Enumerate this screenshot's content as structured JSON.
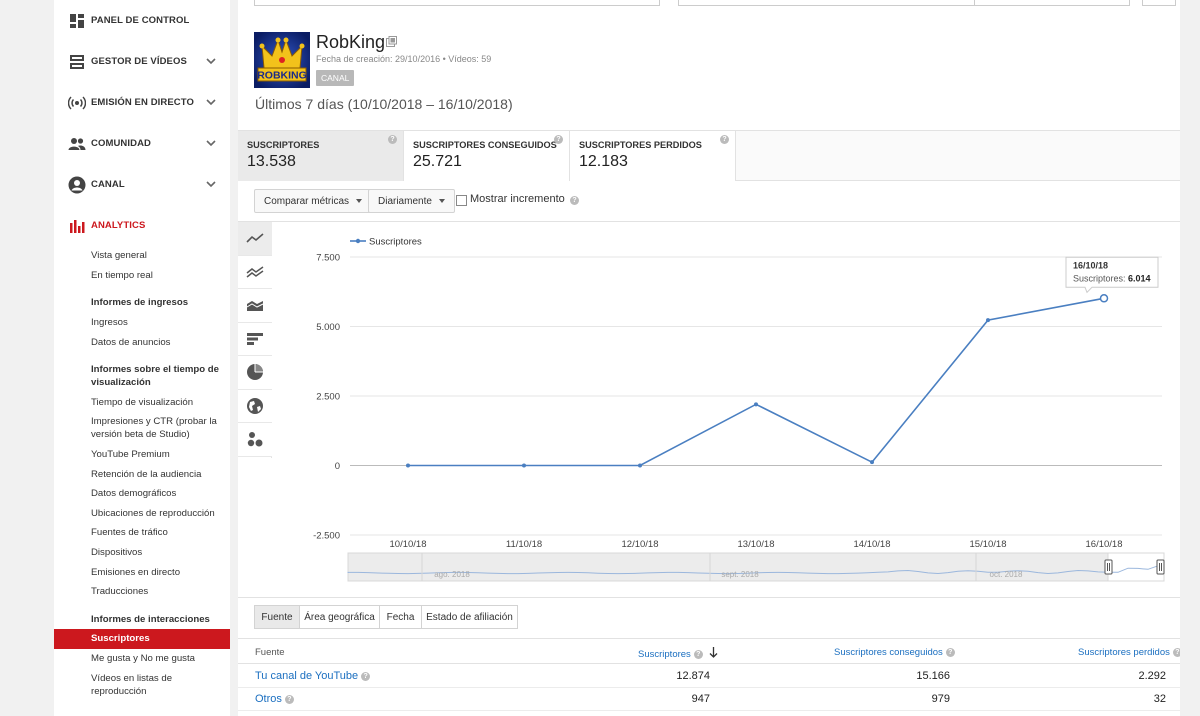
{
  "sidebar": {
    "nav": [
      {
        "label": "PANEL DE CONTROL",
        "icon": "dashboard-icon",
        "chevron": false
      },
      {
        "label": "GESTOR DE VÍDEOS",
        "icon": "video-manager-icon",
        "chevron": true
      },
      {
        "label": "EMISIÓN EN DIRECTO",
        "icon": "live-broadcast-icon",
        "chevron": true
      },
      {
        "label": "COMUNIDAD",
        "icon": "community-icon",
        "chevron": true
      },
      {
        "label": "CANAL",
        "icon": "channel-icon",
        "chevron": true
      },
      {
        "label": "ANALYTICS",
        "icon": "analytics-icon",
        "chevron": false
      }
    ],
    "analytics": {
      "overview": "Vista general",
      "realtime": "En tiempo real",
      "revenue_head": "Informes de ingresos",
      "revenue": "Ingresos",
      "ad_rates": "Datos de anuncios",
      "watch_head": "Informes sobre el tiempo de visualización",
      "watch_time": "Tiempo de visualización",
      "impressions": "Impresiones y CTR (probar la versión beta de Studio)",
      "premium": "YouTube Premium",
      "retention": "Retención de la audiencia",
      "demographics": "Datos demográficos",
      "playback": "Ubicaciones de reproducción",
      "traffic": "Fuentes de tráfico",
      "devices": "Dispositivos",
      "live": "Emisiones en directo",
      "translations": "Traducciones",
      "interaction_head": "Informes de interacciones",
      "subscribers": "Suscriptores",
      "likes": "Me gusta y No me gusta",
      "playlists": "Vídeos en listas de reproducción"
    }
  },
  "channel": {
    "name": "RobKing",
    "avatar_text": "ROBKING",
    "meta": "Fecha de creación: 29/10/2016  •  Vídeos: 59",
    "badge": "CANAL",
    "period": "Últimos 7 días (10/10/2018 – 16/10/2018)"
  },
  "metrics": [
    {
      "label": "SUSCRIPTORES",
      "value": "13.538"
    },
    {
      "label": "SUSCRIPTORES CONSEGUIDOS",
      "value": "25.721"
    },
    {
      "label": "SUSCRIPTORES PERDIDOS",
      "value": "12.183"
    }
  ],
  "controls": {
    "compare": "Comparar métricas",
    "interval": "Diariamente",
    "show_increment": "Mostrar incremento"
  },
  "chart_data": {
    "type": "line",
    "categories": [
      "10/10/18",
      "11/10/18",
      "12/10/18",
      "13/10/18",
      "14/10/18",
      "15/10/18",
      "16/10/18"
    ],
    "series": [
      {
        "name": "Suscriptores",
        "values": [
          0,
          0,
          0,
          2200,
          120,
          5230,
          6014
        ]
      }
    ],
    "yticks": [
      "7.500",
      "5.000",
      "2.500",
      "0",
      "-2.500"
    ],
    "ylim": [
      -2500,
      7500
    ],
    "grid": true,
    "legend": "top-left",
    "color": "#4a7fc1",
    "tooltip": {
      "date": "16/10/18",
      "label": "Suscriptores:",
      "value": "6.014"
    },
    "navigator_labels": [
      "ago. 2018",
      "sept. 2018",
      "oct. 2018"
    ]
  },
  "tabs": [
    "Fuente",
    "Área geográfica",
    "Fecha",
    "Estado de afiliación"
  ],
  "table": {
    "headers": {
      "source": "Fuente",
      "subs": "Suscriptores",
      "gained": "Suscriptores conseguidos",
      "lost": "Suscriptores perdidos"
    },
    "rows": [
      {
        "source": "Tu canal de YouTube",
        "subs": "12.874",
        "gained": "15.166",
        "lost": "2.292"
      },
      {
        "source": "Otros",
        "subs": "947",
        "gained": "979",
        "lost": "32"
      }
    ]
  }
}
